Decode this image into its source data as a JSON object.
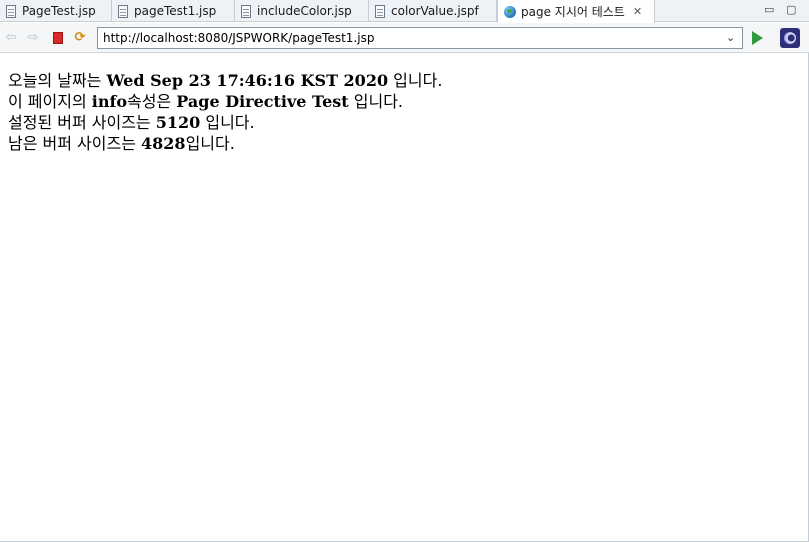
{
  "tabs": [
    {
      "label": "PageTest.jsp",
      "icon": "jsp-file-icon"
    },
    {
      "label": "pageTest1.jsp",
      "icon": "jsp-file-icon"
    },
    {
      "label": "includeColor.jsp",
      "icon": "jsp-file-icon"
    },
    {
      "label": "colorValue.jspf",
      "icon": "jsp-file-icon"
    },
    {
      "label": "page 지시어 테스트",
      "icon": "globe-icon",
      "active": true,
      "close": "✕"
    }
  ],
  "window_controls": {
    "minimize": "▭",
    "maximize": "▢"
  },
  "toolbar": {
    "back": "⇦",
    "forward": "⇨",
    "refresh": "⟳",
    "url": "http://localhost:8080/JSPWORK/pageTest1.jsp",
    "dropdown": "⌄"
  },
  "content": {
    "line1": {
      "prefix": "오늘의 날짜는 ",
      "value": "Wed Sep 23 17:46:16 KST 2020",
      "suffix": " 입니다."
    },
    "line2": {
      "prefix": "이 페이지의 ",
      "key": "info",
      "mid": "속성은 ",
      "value": "Page Directive Test",
      "suffix": " 입니다."
    },
    "line3": {
      "prefix": "설정된 버퍼 사이즈는 ",
      "value": "5120",
      "suffix": " 입니다."
    },
    "line4": {
      "prefix": "남은 버퍼 사이즈는 ",
      "value": "4828",
      "suffix": "입니다."
    }
  },
  "colors": {
    "stop": "#d92b2b",
    "go": "#2f9b3e",
    "tab_bg": "#eef1f5"
  }
}
